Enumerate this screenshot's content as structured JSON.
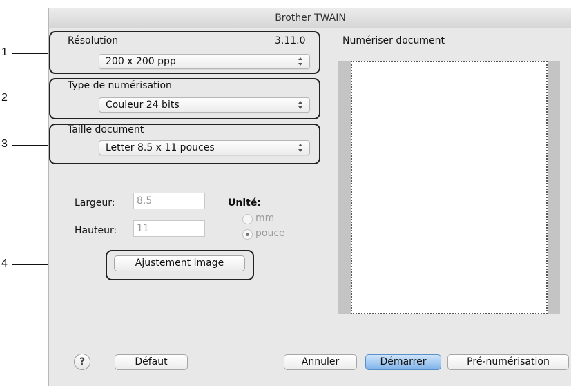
{
  "window": {
    "title": "Brother TWAIN"
  },
  "version": "3.11.0",
  "resolution": {
    "label": "Résolution",
    "value": "200 x 200 ppp"
  },
  "scan_type": {
    "label": "Type de numérisation",
    "value": "Couleur 24 bits"
  },
  "document_size": {
    "label": "Taille document",
    "value": "Letter 8.5 x 11 pouces"
  },
  "dimensions": {
    "width_label": "Largeur:",
    "width_value": "8.5",
    "height_label": "Hauteur:",
    "height_value": "11"
  },
  "unit": {
    "label": "Unité:",
    "options": [
      {
        "label": "mm",
        "selected": false
      },
      {
        "label": "pouce",
        "selected": true
      }
    ]
  },
  "image_adjust_button": "Ajustement image",
  "preview": {
    "label": "Numériser document"
  },
  "footer": {
    "help": "?",
    "default_button": "Défaut",
    "cancel_button": "Annuler",
    "start_button": "Démarrer",
    "prescan_button": "Pré-numérisation"
  },
  "callouts": [
    "1",
    "2",
    "3",
    "4"
  ],
  "colors": {
    "accent": "#7fb2ea",
    "window_bg": "#e8e8e8"
  }
}
